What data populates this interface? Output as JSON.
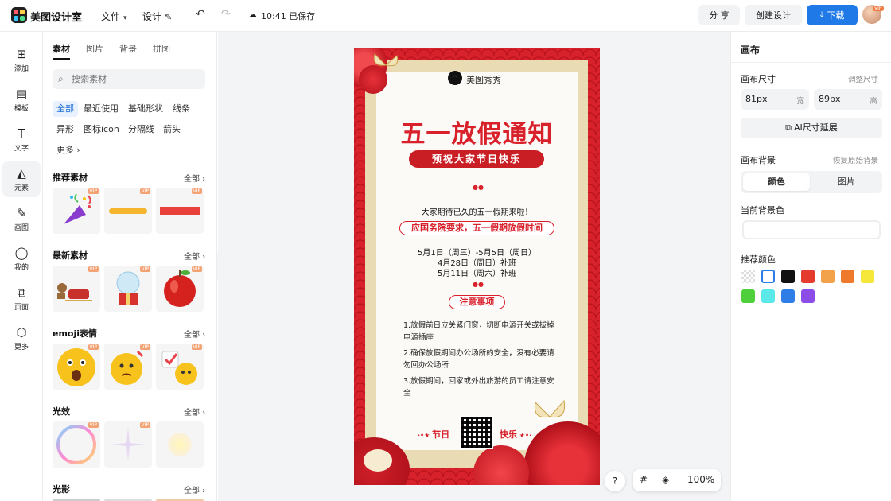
{
  "app": {
    "name": "美图设计室",
    "menu_file": "文件",
    "menu_design": "设计",
    "save_status": "10:41 已保存"
  },
  "header_actions": {
    "share": "分 享",
    "create": "创建设计",
    "download": "下载",
    "avatar_badge": "VIP"
  },
  "rail": [
    {
      "label": "添加",
      "icon": "plus-square-icon"
    },
    {
      "label": "模板",
      "icon": "template-icon"
    },
    {
      "label": "文字",
      "icon": "text-icon"
    },
    {
      "label": "元素",
      "icon": "shapes-icon"
    },
    {
      "label": "画图",
      "icon": "draw-icon"
    },
    {
      "label": "我的",
      "icon": "user-icon"
    },
    {
      "label": "页面",
      "icon": "page-add-icon"
    },
    {
      "label": "更多",
      "icon": "cube-icon"
    }
  ],
  "panel": {
    "tabs": [
      "素材",
      "图片",
      "背景",
      "拼图"
    ],
    "search_placeholder": "搜索素材",
    "chips": [
      "全部",
      "最近使用",
      "基础形状",
      "线条",
      "异形",
      "图标icon",
      "分隔线",
      "箭头",
      "更多"
    ],
    "sections": [
      {
        "title": "推荐素材",
        "all": "全部"
      },
      {
        "title": "最新素材",
        "all": "全部"
      },
      {
        "title": "emoji表情",
        "all": "全部"
      },
      {
        "title": "光效",
        "all": "全部"
      },
      {
        "title": "光影",
        "all": "全部"
      }
    ],
    "vip_label": "VIP"
  },
  "poster": {
    "brand": "美图秀秀",
    "headline": "五一放假通知",
    "subline": "预祝大家节日快乐",
    "intro": "大家期待已久的五一假期来啦！",
    "highlight": "应国务院要求，五一假期放假时间",
    "dates": [
      "5月1日（周三）-5月5日（周日）",
      "4月28日（周日）补班",
      "5月11日（周六）补班"
    ],
    "notice_title": "注意事项",
    "notices": [
      "1.放假前日应关紧门窗，切断电源开关或拔掉电源插座",
      "2.确保放假期间办公场所的安全，没有必要请勿回办公场所",
      "3.放假期间，回家或外出旅游的员工请注意安全"
    ],
    "footer_left": "节日",
    "footer_right": "快乐"
  },
  "zoom": {
    "help": "?",
    "level": "100%"
  },
  "right_panel": {
    "title": "画布",
    "size_label": "画布尺寸",
    "size_link": "调整尺寸",
    "width_value": "81px",
    "width_unit": "宽",
    "height_value": "89px",
    "height_unit": "高",
    "ai_extend": "AI尺寸延展",
    "bg_label": "画布背景",
    "bg_reset": "恢复原始背景",
    "seg_color": "颜色",
    "seg_image": "图片",
    "current_bg_label": "当前背景色",
    "recommend_label": "推荐颜色",
    "swatches": [
      "transparent",
      "#ffffff",
      "#111111",
      "#e53a2e",
      "#f2a24a",
      "#f07a2c",
      "#f5e83a",
      "#4fcf3a",
      "#5ae8e8",
      "#2f7ee8",
      "#8b4ce8"
    ]
  }
}
